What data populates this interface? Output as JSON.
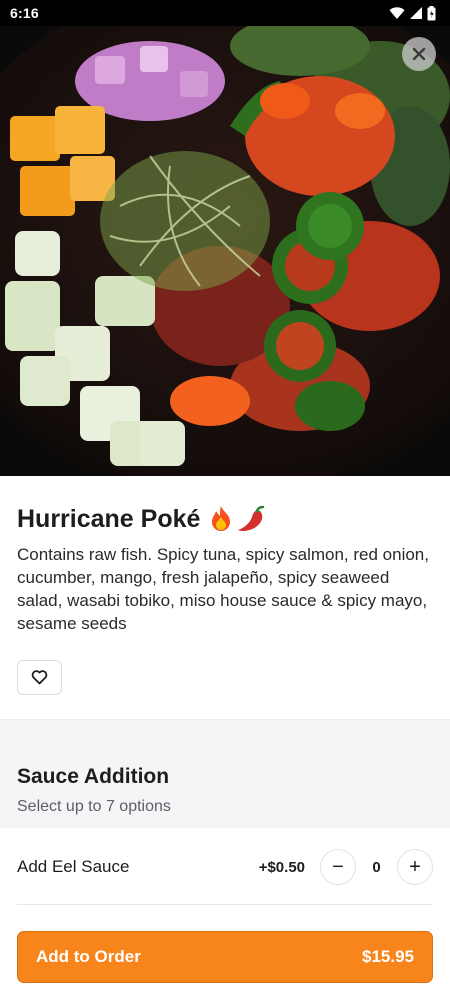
{
  "status_bar": {
    "time": "6:16"
  },
  "item": {
    "title": "Hurricane Poké",
    "title_emojis": [
      "fire-icon",
      "chili-pepper-icon"
    ],
    "description": "Contains raw fish. Spicy tuna, spicy salmon, red onion, cucumber, mango, fresh jalapeño, spicy seaweed salad, wasabi tobiko, miso house sauce & spicy mayo, sesame seeds"
  },
  "section": {
    "title": "Sauce Addition",
    "subtitle": "Select up to 7 options"
  },
  "options": [
    {
      "name": "Add Eel Sauce",
      "price": "+$0.50",
      "quantity": "0",
      "minus": "−",
      "plus": "+"
    }
  ],
  "order": {
    "label": "Add to Order",
    "price": "$15.95"
  },
  "colors": {
    "accent": "#f7851c",
    "section_bg": "#f5f5f7"
  }
}
